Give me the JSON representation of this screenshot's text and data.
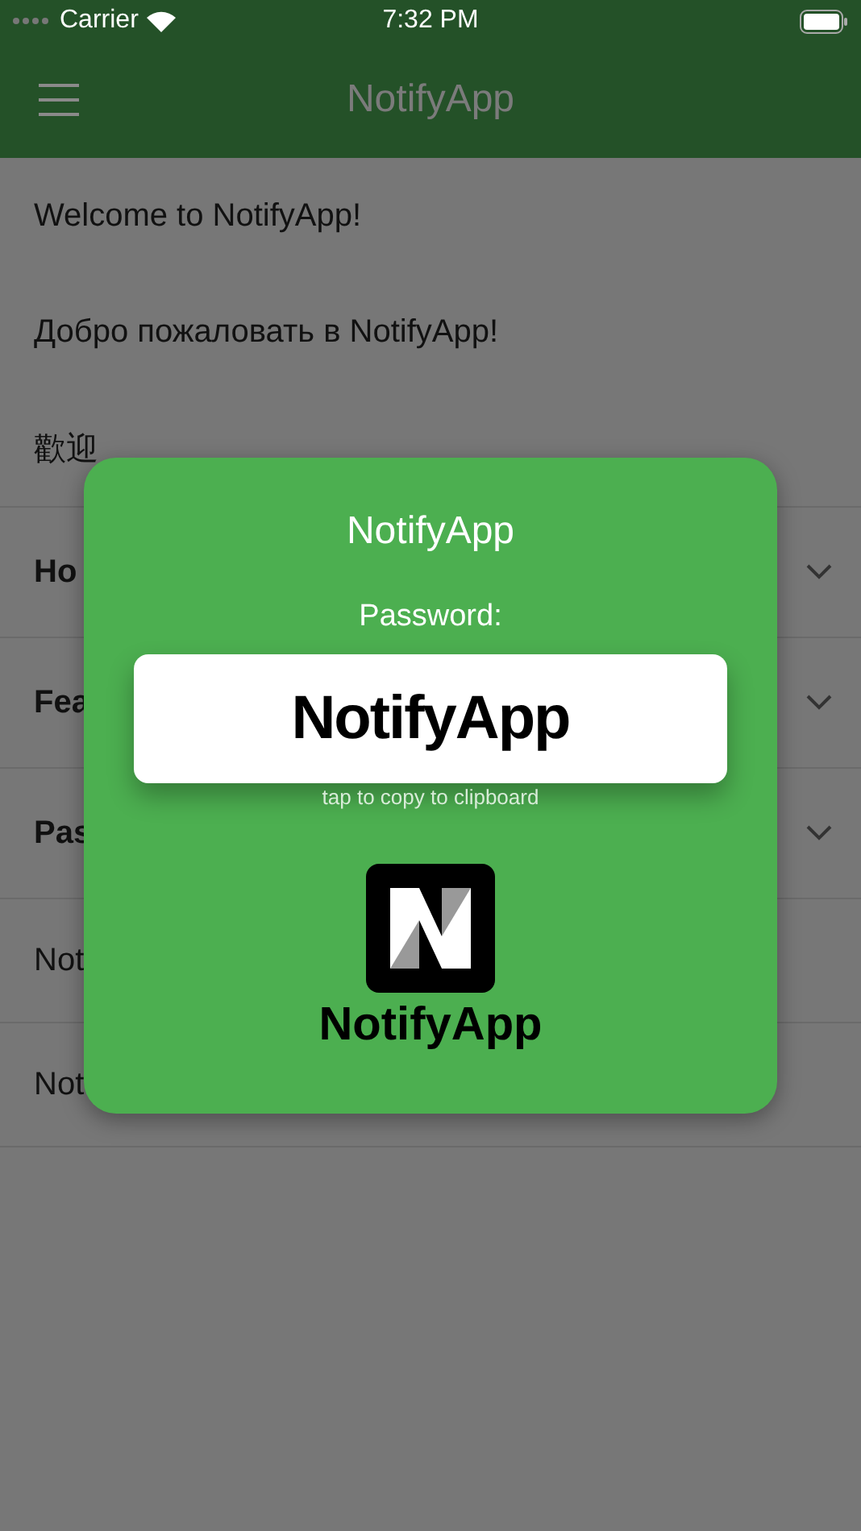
{
  "status_bar": {
    "carrier": "Carrier",
    "time": "7:32 PM"
  },
  "nav_bar": {
    "title": "NotifyApp"
  },
  "list": [
    {
      "kind": "plain",
      "text": "Welcome to NotifyApp!"
    },
    {
      "kind": "plain",
      "text": "Добро пожаловать в NotifyApp!"
    },
    {
      "kind": "plain",
      "text": "歡迎"
    },
    {
      "kind": "section",
      "text": "Ho",
      "expanded": false
    },
    {
      "kind": "section",
      "text": "Fea",
      "expanded": false
    },
    {
      "kind": "section",
      "text": "Pas",
      "expanded": false
    },
    {
      "kind": "note",
      "text": "Not"
    },
    {
      "kind": "note",
      "text": "Not"
    }
  ],
  "dialog": {
    "title": "NotifyApp",
    "label": "Password:",
    "password": "NotifyApp",
    "hint": "tap to copy to clipboard",
    "logo_text": "NotifyApp"
  }
}
